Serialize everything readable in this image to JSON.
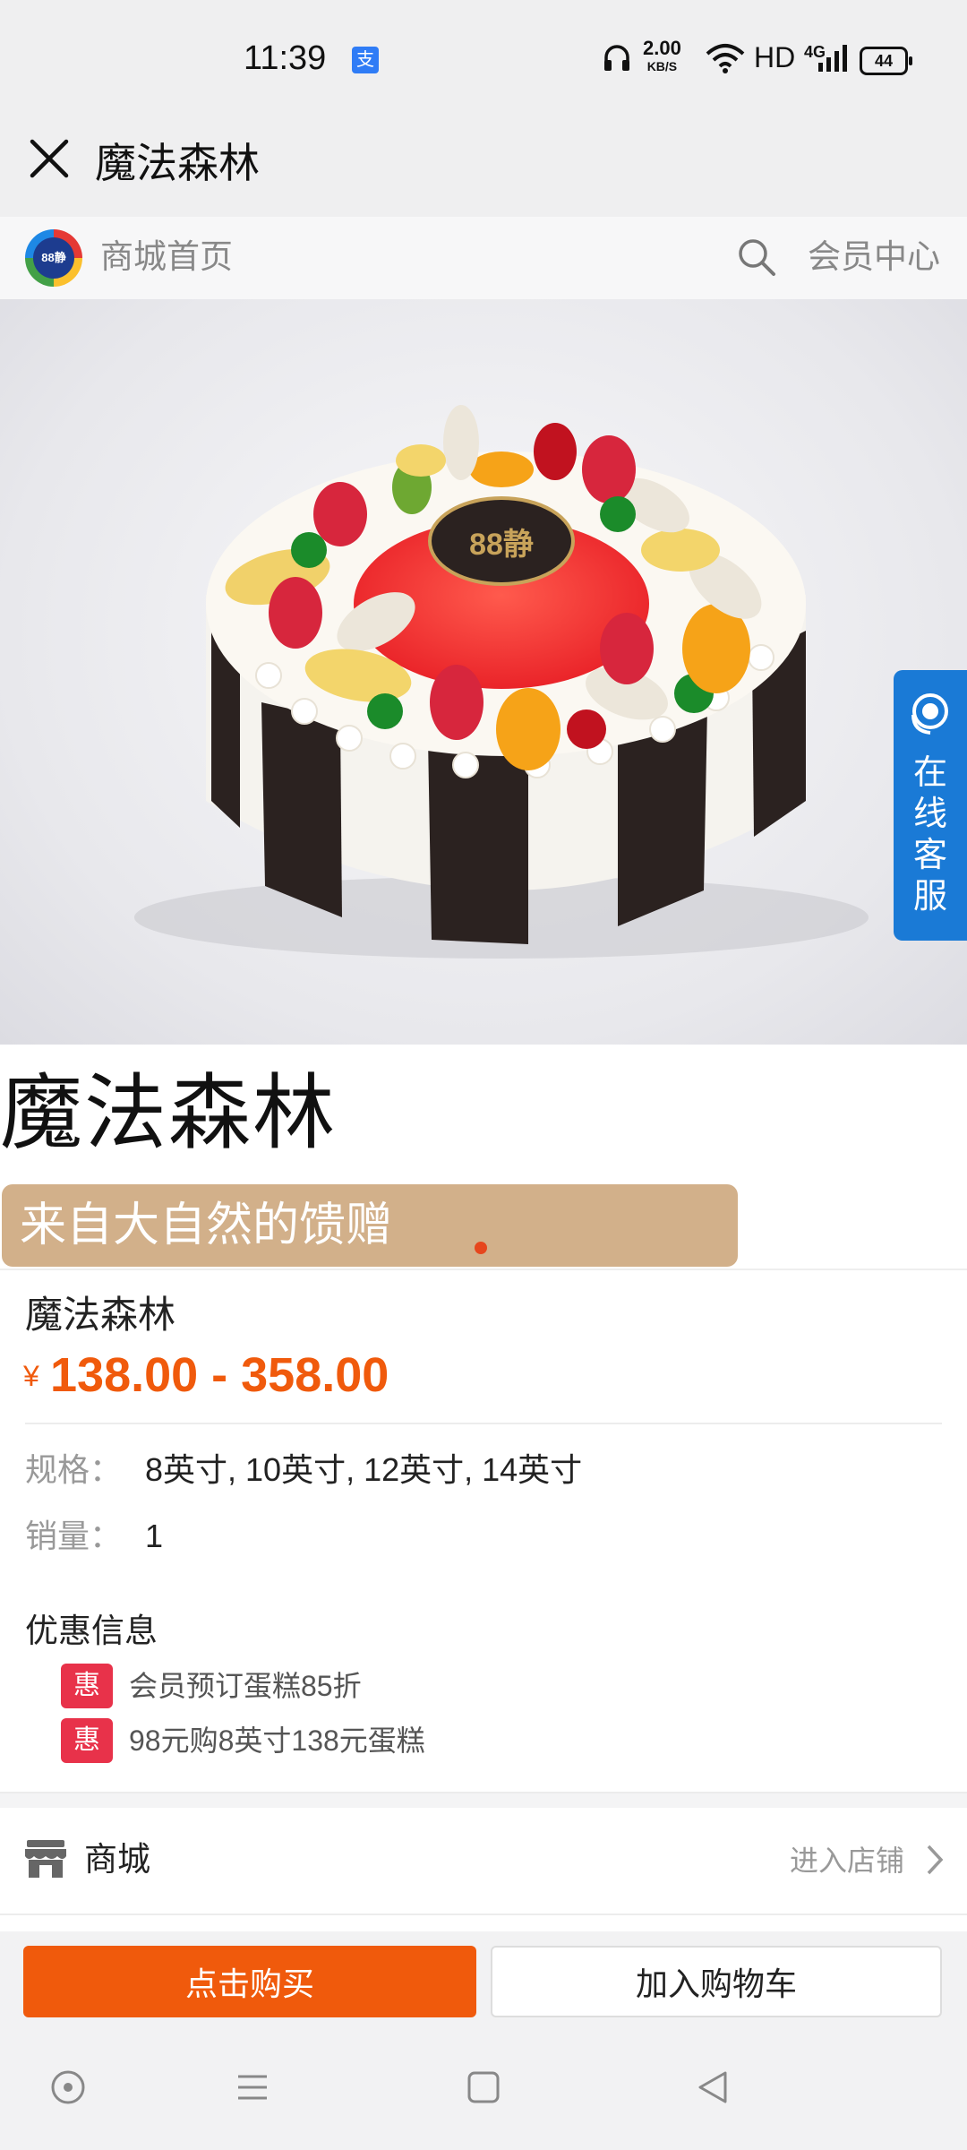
{
  "status_bar": {
    "time": "11:39",
    "app_badge": "支",
    "net_speed": "2.00",
    "net_speed_unit": "KB/S",
    "hd": "HD",
    "network": "4G",
    "battery": "44"
  },
  "title_bar": {
    "title": "魔法森林"
  },
  "shop_nav": {
    "logo_text": "88静",
    "home_label": "商城首页",
    "member_label": "会员中心"
  },
  "hero": {
    "plaque_text": "88静",
    "customer_service": [
      "在",
      "线",
      "客",
      "服"
    ]
  },
  "product": {
    "big_title": "魔法森林",
    "slogan": "来自大自然的馈赠",
    "name": "魔法森林",
    "currency": "¥",
    "price_range": "138.00 - 358.00",
    "spec_label": "规格：",
    "spec_value": "8英寸, 10英寸, 12英寸, 14英寸",
    "sales_label": "销量：",
    "sales_value": "1"
  },
  "promotions": {
    "title": "优惠信息",
    "items": [
      {
        "tag": "惠",
        "text": "会员预订蛋糕85折"
      },
      {
        "tag": "惠",
        "text": "98元购8英寸138元蛋糕"
      }
    ]
  },
  "store": {
    "label": "商城",
    "enter_label": "进入店铺"
  },
  "actions": {
    "buy_label": "点击购买",
    "cart_label": "加入购物车"
  },
  "colors": {
    "accent": "#f05a0c",
    "promo_tag": "#e8324a",
    "slogan_bg": "#d2b08a",
    "service_tab": "#1a7ad6"
  }
}
